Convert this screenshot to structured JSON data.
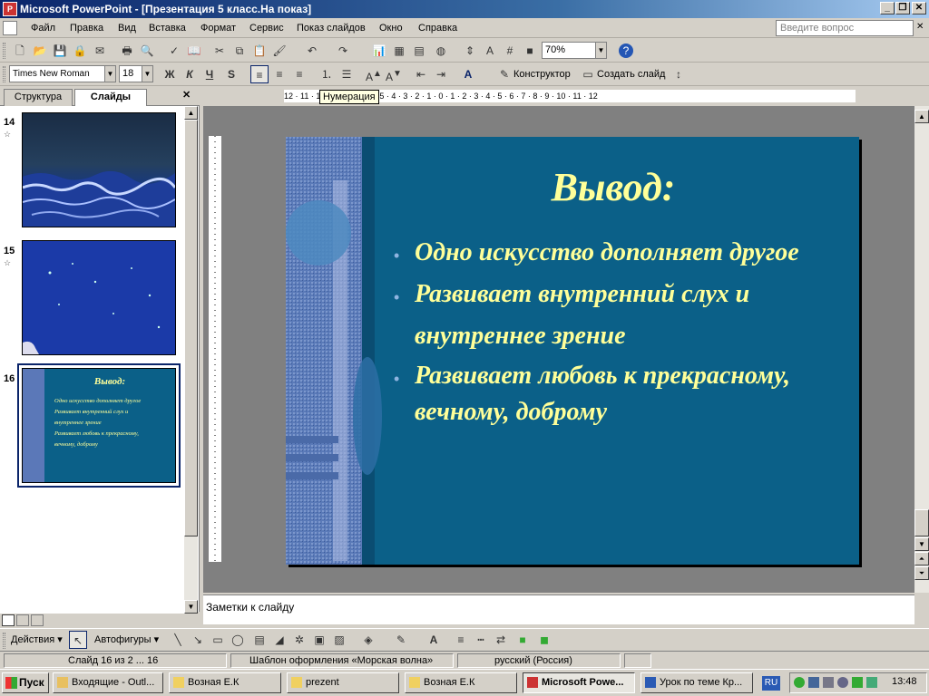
{
  "window": {
    "title": "Microsoft PowerPoint - [Презентация 5 класс.На показ]",
    "app_icon": "P",
    "min": "_",
    "restore": "❐",
    "close": "✕"
  },
  "menu": {
    "items": [
      "Файл",
      "Правка",
      "Вид",
      "Вставка",
      "Формат",
      "Сервис",
      "Показ слайдов",
      "Окно",
      "Справка"
    ],
    "ask_placeholder": "Введите вопрос",
    "close": "✕"
  },
  "toolbar1": {
    "zoom": "70%",
    "help": "?"
  },
  "toolbar2": {
    "font": "Times New Roman",
    "size": "18",
    "bold": "Ж",
    "italic": "К",
    "underline": "Ч",
    "shadow": "S",
    "design": "Конструктор",
    "new_slide": "Создать слайд"
  },
  "tooltip": "Нумерация",
  "panes": {
    "tab_outline": "Структура",
    "tab_slides": "Слайды",
    "close": "✕"
  },
  "thumbnails": [
    {
      "num": "14",
      "star": "☆"
    },
    {
      "num": "15",
      "star": "☆"
    },
    {
      "num": "16",
      "star": ""
    }
  ],
  "ruler": {
    "h": "12 · 11 · 10 · 9 · 8 · 7 · 6 · 5 · 4 · 3 · 2 · 1 · 0 · 1 · 2 · 3 · 4 · 5 · 6 · 7 · 8 · 9 · 10 · 11 · 12"
  },
  "slide": {
    "title": "Вывод:",
    "bullets": [
      "Одно искусство дополняет другое",
      "Развивает внутренний слух и",
      " внутреннее зрение",
      "Развивает любовь к прекрасному,",
      "вечному, доброму"
    ],
    "bullet_char": "•",
    "colors": {
      "bg": "#0b6088",
      "text": "#ffff99",
      "title": "#ffff99",
      "bullet": "#8fb4e0"
    }
  },
  "notes": {
    "placeholder": "Заметки к слайду"
  },
  "draw_toolbar": {
    "actions": "Действия ▾",
    "autoshapes": "Автофигуры ▾"
  },
  "status": {
    "slide": "Слайд 16 из 2 ... 16",
    "template": "Шаблон оформления «Морская волна»",
    "lang": "русский (Россия)"
  },
  "taskbar": {
    "start": "Пуск",
    "tasks": [
      "Входящие - Outl...",
      "Возная Е.К",
      "prezent",
      "Возная Е.К",
      "Microsoft Powe...",
      "Урок по теме Кр..."
    ],
    "lang": "RU",
    "time": "13:48"
  }
}
